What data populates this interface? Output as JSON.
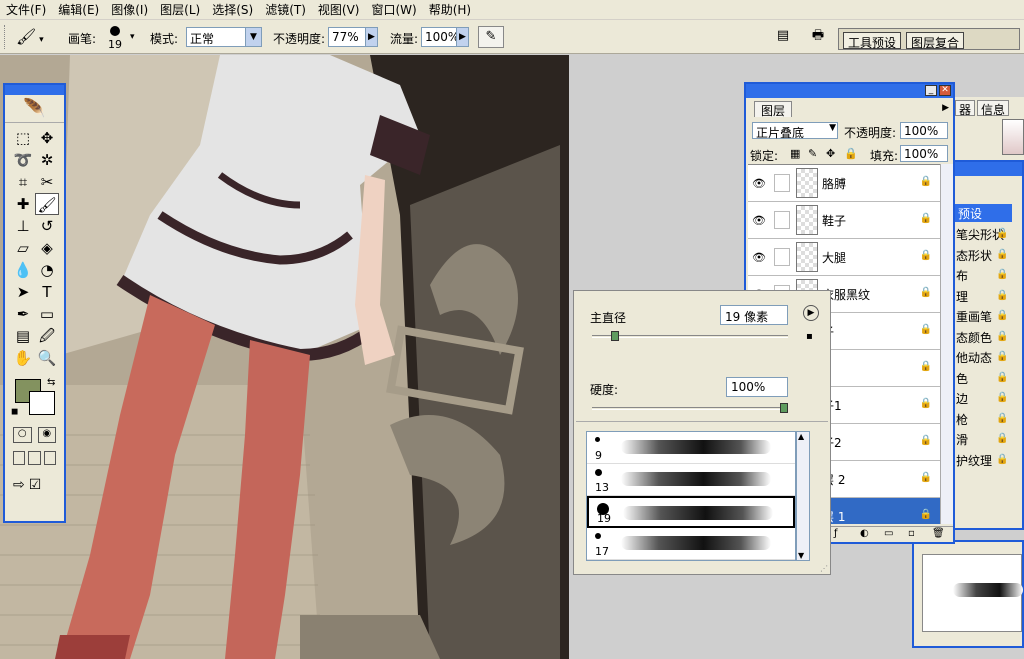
{
  "menu": [
    "文件(F)",
    "编辑(E)",
    "图像(I)",
    "图层(L)",
    "选择(S)",
    "滤镜(T)",
    "视图(V)",
    "窗口(W)",
    "帮助(H)"
  ],
  "options": {
    "brush_label": "画笔:",
    "brush_size": "19",
    "mode_label": "模式:",
    "mode_value": "正常",
    "opacity_label": "不透明度:",
    "opacity_value": "77%",
    "flow_label": "流量:",
    "flow_value": "100%",
    "tab_tool_presets": "工具预设",
    "tab_layer_comps": "图层复合"
  },
  "colors": {
    "foreground": "#83925f",
    "background": "#ffffff",
    "titlebar": "#2f6ee9",
    "selection": "#316ac5"
  },
  "tools": [
    [
      "marquee-icon",
      "move-icon"
    ],
    [
      "lasso-icon",
      "magic-wand-icon"
    ],
    [
      "crop-icon",
      "slice-icon"
    ],
    [
      "healing-brush-icon",
      "brush-icon"
    ],
    [
      "clone-stamp-icon",
      "history-brush-icon"
    ],
    [
      "eraser-icon",
      "paint-bucket-icon"
    ],
    [
      "blur-icon",
      "dodge-icon"
    ],
    [
      "path-select-icon",
      "type-icon"
    ],
    [
      "pen-icon",
      "shape-icon"
    ],
    [
      "notes-icon",
      "eyedropper-icon"
    ],
    [
      "hand-icon",
      "zoom-icon"
    ]
  ],
  "brush_popup": {
    "master_diameter_label": "主直径",
    "master_diameter_value": "19 像素",
    "hardness_label": "硬度:",
    "hardness_value": "100%",
    "diameter_fraction": 0.1,
    "hardness_fraction": 1.0,
    "presets": [
      {
        "size": "9"
      },
      {
        "size": "13"
      },
      {
        "size": "19"
      },
      {
        "size": "17"
      }
    ]
  },
  "layers": {
    "tab": "图层",
    "blend_mode": "正片叠底",
    "opacity_label": "不透明度:",
    "opacity_value": "100%",
    "lock_label": "锁定:",
    "fill_label": "填充:",
    "fill_value": "100%",
    "items": [
      {
        "name": "胳膊",
        "selected": false
      },
      {
        "name": "鞋子",
        "selected": false
      },
      {
        "name": "大腿",
        "selected": false
      },
      {
        "name": "衣服黑纹",
        "selected": false
      },
      {
        "name": "子",
        "selected": false
      },
      {
        "name": "",
        "selected": false
      },
      {
        "name": "子1",
        "selected": false
      },
      {
        "name": "子2",
        "selected": false
      },
      {
        "name": "层 2",
        "selected": false
      },
      {
        "name": "层 1",
        "selected": true
      }
    ]
  },
  "behind_panel": {
    "header_partial": "预设",
    "options": [
      "笔尖形状",
      "态形状",
      "布",
      "理",
      "重画笔",
      "态颜色",
      "他动态",
      "色",
      "边",
      "枪",
      "滑",
      "护纹理"
    ],
    "tabs_partial": [
      "器",
      "信息"
    ]
  }
}
